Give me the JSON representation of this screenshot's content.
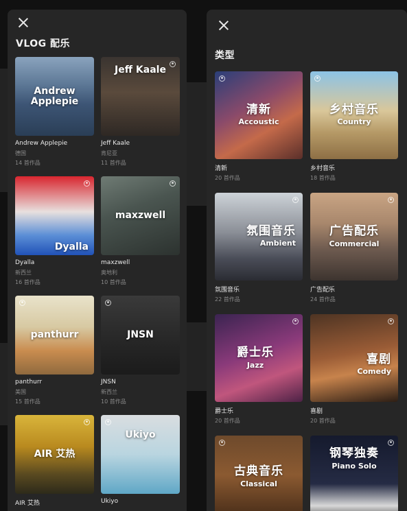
{
  "colors": {
    "panel_bg": "#262626",
    "page_bg": "#111111",
    "muted_text": "#8a8a8a"
  },
  "left_panel": {
    "title": "VLOG 配乐",
    "close_icon": "close-icon",
    "artists": [
      {
        "overlay": "Andrew Applepie",
        "name": "Andrew Applepie",
        "region": "德国",
        "count": "14 首作品"
      },
      {
        "overlay": "Jeff Kaale",
        "name": "Jeff Kaale",
        "region": "肯尼亚",
        "count": "11 首作品"
      },
      {
        "overlay": "Dyalla",
        "name": "Dyalla",
        "region": "新西兰",
        "count": "16 首作品"
      },
      {
        "overlay": "maxzwell",
        "name": "maxzwell",
        "region": "奥地利",
        "count": "10 首作品"
      },
      {
        "overlay": "panthurr",
        "name": "panthurr",
        "region": "美国",
        "count": "15 首作品"
      },
      {
        "overlay": "JNSN",
        "name": "JNSN",
        "region": "新西兰",
        "count": "10 首作品"
      },
      {
        "overlay": "AIR 艾热",
        "name": "AIR 艾热",
        "region": "",
        "count": ""
      },
      {
        "overlay": "Ukiyo",
        "name": "Ukiyo",
        "region": "",
        "count": ""
      }
    ]
  },
  "right_panel": {
    "title": "类型",
    "close_icon": "close-icon",
    "genres": [
      {
        "overlay_cn": "清新",
        "overlay_en": "Accoustic",
        "name": "清新",
        "count": "20 首作品"
      },
      {
        "overlay_cn": "乡村音乐",
        "overlay_en": "Country",
        "name": "乡村音乐",
        "count": "18 首作品"
      },
      {
        "overlay_cn": "氛围音乐",
        "overlay_en": "Ambient",
        "name": "氛围音乐",
        "count": "22 首作品"
      },
      {
        "overlay_cn": "广告配乐",
        "overlay_en": "Commercial",
        "name": "广告配乐",
        "count": "24 首作品"
      },
      {
        "overlay_cn": "爵士乐",
        "overlay_en": "Jazz",
        "name": "爵士乐",
        "count": "20 首作品"
      },
      {
        "overlay_cn": "喜剧",
        "overlay_en": "Comedy",
        "name": "喜剧",
        "count": "20 首作品"
      },
      {
        "overlay_cn": "古典音乐",
        "overlay_en": "Classical",
        "name": "",
        "count": ""
      },
      {
        "overlay_cn": "钢琴独奏",
        "overlay_en": "Piano Solo",
        "name": "",
        "count": ""
      }
    ]
  }
}
